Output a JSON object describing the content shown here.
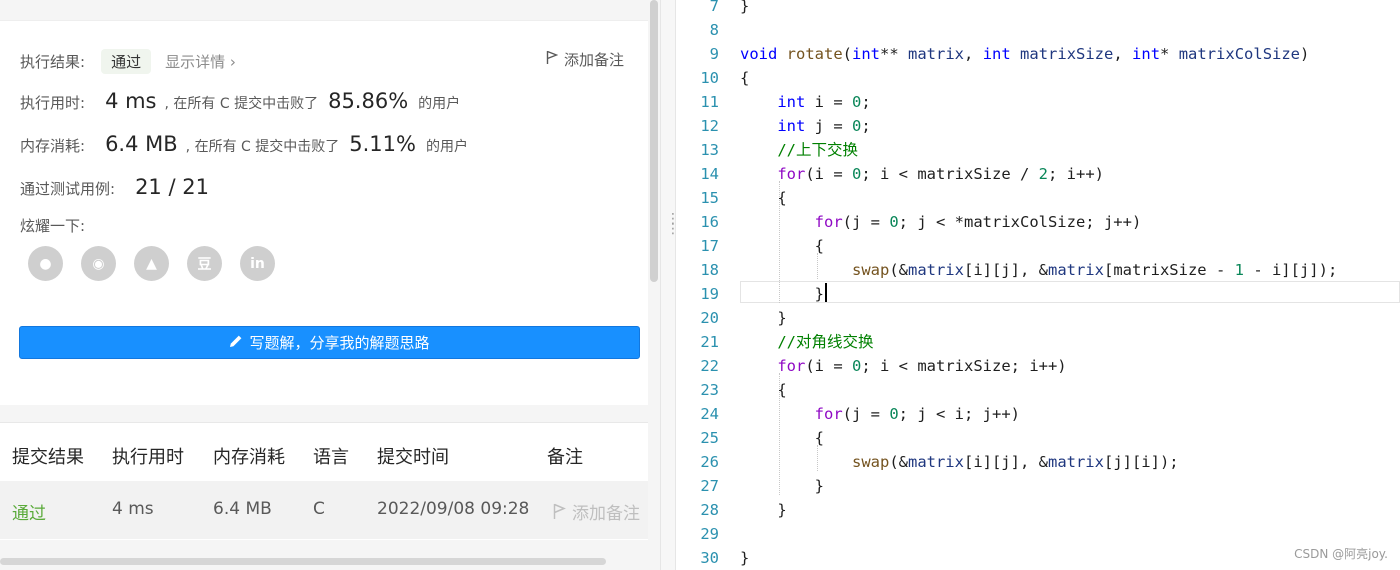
{
  "result": {
    "exec_result_label": "执行结果:",
    "status": "通过",
    "details_link": "显示详情 ›",
    "add_note": "添加备注",
    "runtime_label": "执行用时:",
    "runtime_value": "4 ms",
    "beat_prefix": ", 在所有 C 提交中击败了",
    "runtime_beat": "85.86%",
    "beat_suffix": "的用户",
    "memory_label": "内存消耗:",
    "memory_value": "6.4 MB",
    "memory_beat": "5.11%",
    "tests_label": "通过测试用例:",
    "tests_value": "21 / 21",
    "share_label": "炫耀一下:",
    "write_solution": "写题解，分享我的解题思路"
  },
  "share_icons": [
    {
      "icon": "wechat-icon",
      "glyph": "●"
    },
    {
      "icon": "weibo-icon",
      "glyph": "◉"
    },
    {
      "icon": "qq-icon",
      "glyph": "▲"
    },
    {
      "icon": "douban-icon",
      "glyph": "豆"
    },
    {
      "icon": "linkedin-icon",
      "glyph": "in"
    }
  ],
  "submissions": {
    "headers": [
      "提交结果",
      "执行用时",
      "内存消耗",
      "语言",
      "提交时间",
      "备注"
    ],
    "rows": [
      {
        "status": "通过",
        "runtime": "4 ms",
        "memory": "6.4 MB",
        "language": "C",
        "time": "2022/09/08 09:28",
        "note": "添加备注"
      }
    ]
  },
  "code": {
    "lines": [
      {
        "n": "7",
        "tokens": [
          [
            "}",
            ""
          ]
        ]
      },
      {
        "n": "8",
        "tokens": []
      },
      {
        "n": "9",
        "tokens": [
          [
            "void",
            "kw"
          ],
          [
            " ",
            ""
          ],
          [
            "rotate",
            "fn"
          ],
          [
            "(",
            ""
          ],
          [
            "int",
            "kw"
          ],
          [
            "** ",
            ""
          ],
          [
            "matrix",
            "var"
          ],
          [
            ", ",
            ""
          ],
          [
            "int",
            "kw"
          ],
          [
            " ",
            ""
          ],
          [
            "matrixSize",
            "var"
          ],
          [
            ", ",
            ""
          ],
          [
            "int",
            "kw"
          ],
          [
            "* ",
            ""
          ],
          [
            "matrixColSize",
            "var"
          ],
          [
            ")",
            ""
          ]
        ]
      },
      {
        "n": "10",
        "tokens": [
          [
            "{",
            ""
          ]
        ]
      },
      {
        "n": "11",
        "tokens": [
          [
            "    ",
            ""
          ],
          [
            "int",
            "kw"
          ],
          [
            " i = ",
            ""
          ],
          [
            "0",
            "num"
          ],
          [
            ";",
            ""
          ]
        ]
      },
      {
        "n": "12",
        "tokens": [
          [
            "    ",
            ""
          ],
          [
            "int",
            "kw"
          ],
          [
            " j = ",
            ""
          ],
          [
            "0",
            "num"
          ],
          [
            ";",
            ""
          ]
        ]
      },
      {
        "n": "13",
        "tokens": [
          [
            "    ",
            ""
          ],
          [
            "//上下交换",
            "cmt"
          ]
        ]
      },
      {
        "n": "14",
        "tokens": [
          [
            "    ",
            ""
          ],
          [
            "for",
            "ctl"
          ],
          [
            "(i = ",
            ""
          ],
          [
            "0",
            "num"
          ],
          [
            "; i < matrixSize / ",
            ""
          ],
          [
            "2",
            "num"
          ],
          [
            "; i++)",
            ""
          ]
        ]
      },
      {
        "n": "15",
        "tokens": [
          [
            "    {",
            ""
          ]
        ]
      },
      {
        "n": "16",
        "tokens": [
          [
            "        ",
            ""
          ],
          [
            "for",
            "ctl"
          ],
          [
            "(j = ",
            ""
          ],
          [
            "0",
            "num"
          ],
          [
            "; j < *matrixColSize; j++)",
            ""
          ]
        ]
      },
      {
        "n": "17",
        "tokens": [
          [
            "        {",
            ""
          ]
        ]
      },
      {
        "n": "18",
        "tokens": [
          [
            "            ",
            ""
          ],
          [
            "swap",
            "fn"
          ],
          [
            "(&",
            ""
          ],
          [
            "matrix",
            "var"
          ],
          [
            "[i][j], &",
            ""
          ],
          [
            "matrix",
            "var"
          ],
          [
            "[matrixSize - ",
            ""
          ],
          [
            "1",
            "num"
          ],
          [
            " - i][j]);",
            ""
          ]
        ]
      },
      {
        "n": "19",
        "tokens": [
          [
            "        }",
            ""
          ]
        ]
      },
      {
        "n": "20",
        "tokens": [
          [
            "    }",
            ""
          ]
        ]
      },
      {
        "n": "21",
        "tokens": [
          [
            "    ",
            ""
          ],
          [
            "//对角线交换",
            "cmt"
          ]
        ]
      },
      {
        "n": "22",
        "tokens": [
          [
            "    ",
            ""
          ],
          [
            "for",
            "ctl"
          ],
          [
            "(i = ",
            ""
          ],
          [
            "0",
            "num"
          ],
          [
            "; i < matrixSize; i++)",
            ""
          ]
        ]
      },
      {
        "n": "23",
        "tokens": [
          [
            "    {",
            ""
          ]
        ]
      },
      {
        "n": "24",
        "tokens": [
          [
            "        ",
            ""
          ],
          [
            "for",
            "ctl"
          ],
          [
            "(j = ",
            ""
          ],
          [
            "0",
            "num"
          ],
          [
            "; j < i; j++)",
            ""
          ]
        ]
      },
      {
        "n": "25",
        "tokens": [
          [
            "        {",
            ""
          ]
        ]
      },
      {
        "n": "26",
        "tokens": [
          [
            "            ",
            ""
          ],
          [
            "swap",
            "fn"
          ],
          [
            "(&",
            ""
          ],
          [
            "matrix",
            "var"
          ],
          [
            "[i][j], &",
            ""
          ],
          [
            "matrix",
            "var"
          ],
          [
            "[j][i]);",
            ""
          ]
        ]
      },
      {
        "n": "27",
        "tokens": [
          [
            "        }",
            ""
          ]
        ]
      },
      {
        "n": "28",
        "tokens": [
          [
            "    }",
            ""
          ]
        ]
      },
      {
        "n": "29",
        "tokens": []
      },
      {
        "n": "30",
        "tokens": [
          [
            "}",
            ""
          ]
        ]
      }
    ]
  },
  "watermark": "CSDN @阿亮joy."
}
